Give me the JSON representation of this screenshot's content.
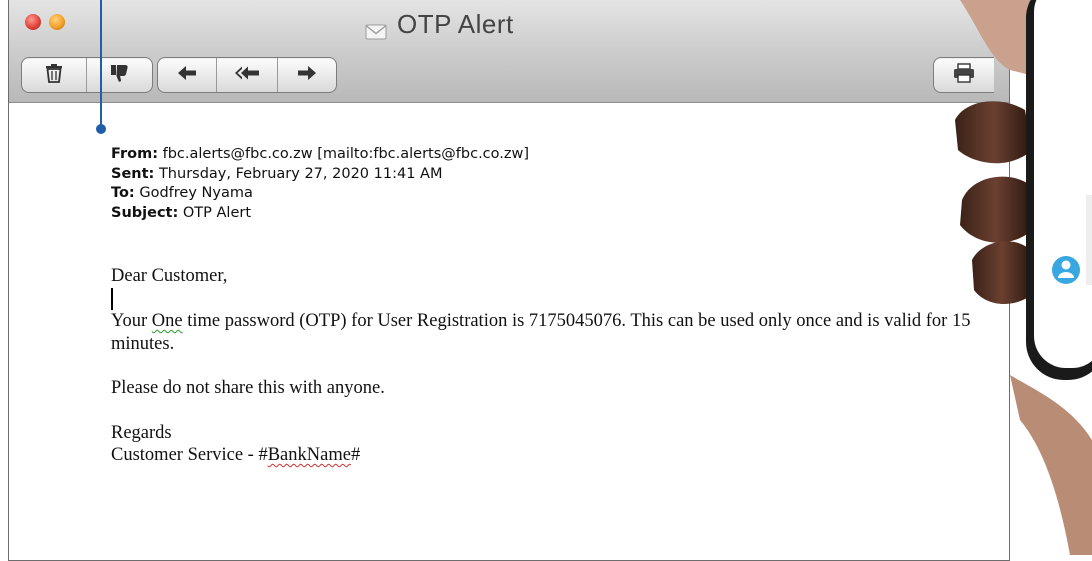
{
  "window": {
    "title": "OTP Alert",
    "toolbar": {
      "buttons": [
        "delete",
        "junk",
        "reply",
        "reply-all",
        "forward",
        "print"
      ]
    }
  },
  "email": {
    "from_label": "From:",
    "from_value": "fbc.alerts@fbc.co.zw [mailto:fbc.alerts@fbc.co.zw]",
    "sent_label": "Sent:",
    "sent_value": "Thursday, February 27, 2020 11:41 AM",
    "to_label": "To:",
    "to_value": "Godfrey Nyama",
    "subject_label": "Subject:",
    "subject_value": "OTP Alert",
    "greeting": "Dear Customer,",
    "otp_line_pre": "Your ",
    "otp_line_flag": "One",
    "otp_line_post": " time password (OTP) for User Registration is 7175045076. This can be used only once and is valid for 15 minutes.",
    "warning": "Please do not share this with anyone.",
    "regards": "Regards",
    "signature_pre": "Customer Service - #",
    "signature_flag": "BankName",
    "signature_post": "#"
  },
  "colors": {
    "pointer": "#1f5fa8",
    "phone_accent": "#3aa8e0"
  }
}
